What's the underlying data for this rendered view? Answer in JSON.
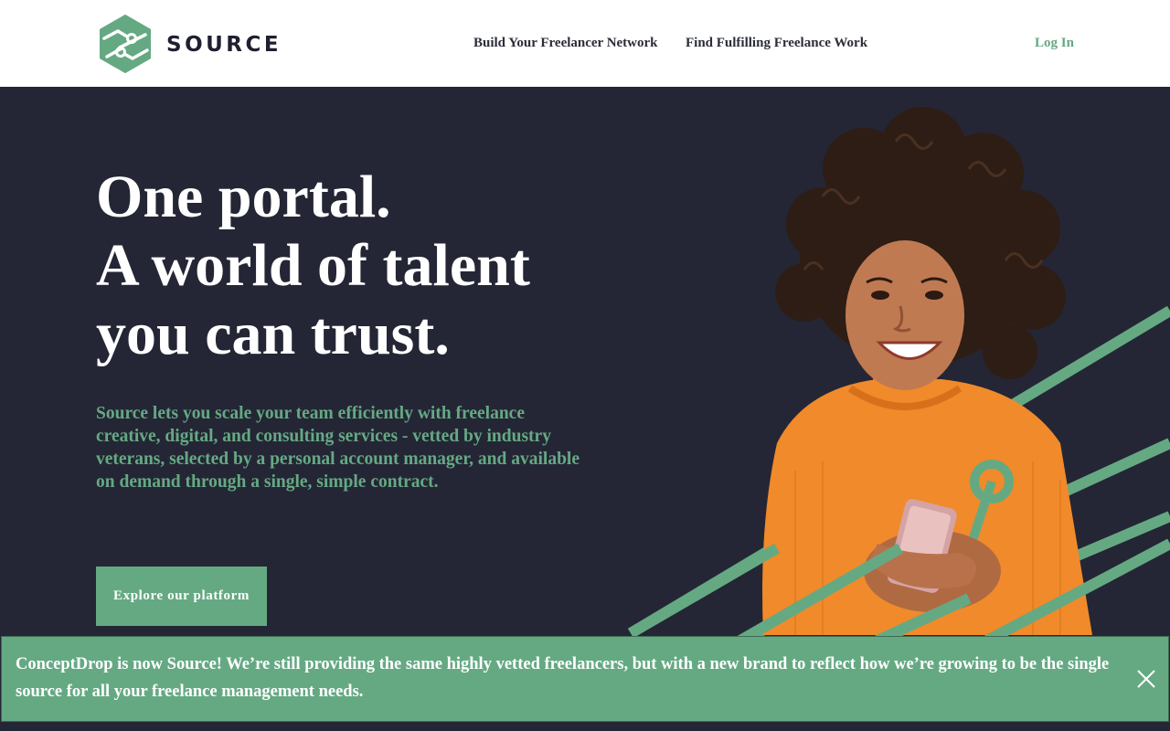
{
  "brand": {
    "name": "SOURCE",
    "logo_icon": "source-s-logo-icon",
    "accent_color": "#65a983",
    "dark_color": "#242635"
  },
  "nav": {
    "items": [
      {
        "label": "Build Your Freelancer Network"
      },
      {
        "label": "Find Fulfilling Freelance Work"
      }
    ],
    "login_label": "Log In"
  },
  "hero": {
    "headline": [
      "One portal.",
      "A world of talent",
      "you can trust."
    ],
    "lead": "Source lets you scale your team efficiently with freelance creative, digital, and consulting services - vetted by industry veterans, selected by a personal account manager, and available on demand through a single, simple contract.",
    "cta_label": "Explore our platform",
    "image_icon": "smiling-woman-with-phone-illustration"
  },
  "banner": {
    "message": "ConceptDrop is now Source! We’re still providing the same highly vetted freelancers, but with a new brand to reflect how we’re growing to be the single source for all your freelance management needs.",
    "close_icon": "close-icon"
  }
}
